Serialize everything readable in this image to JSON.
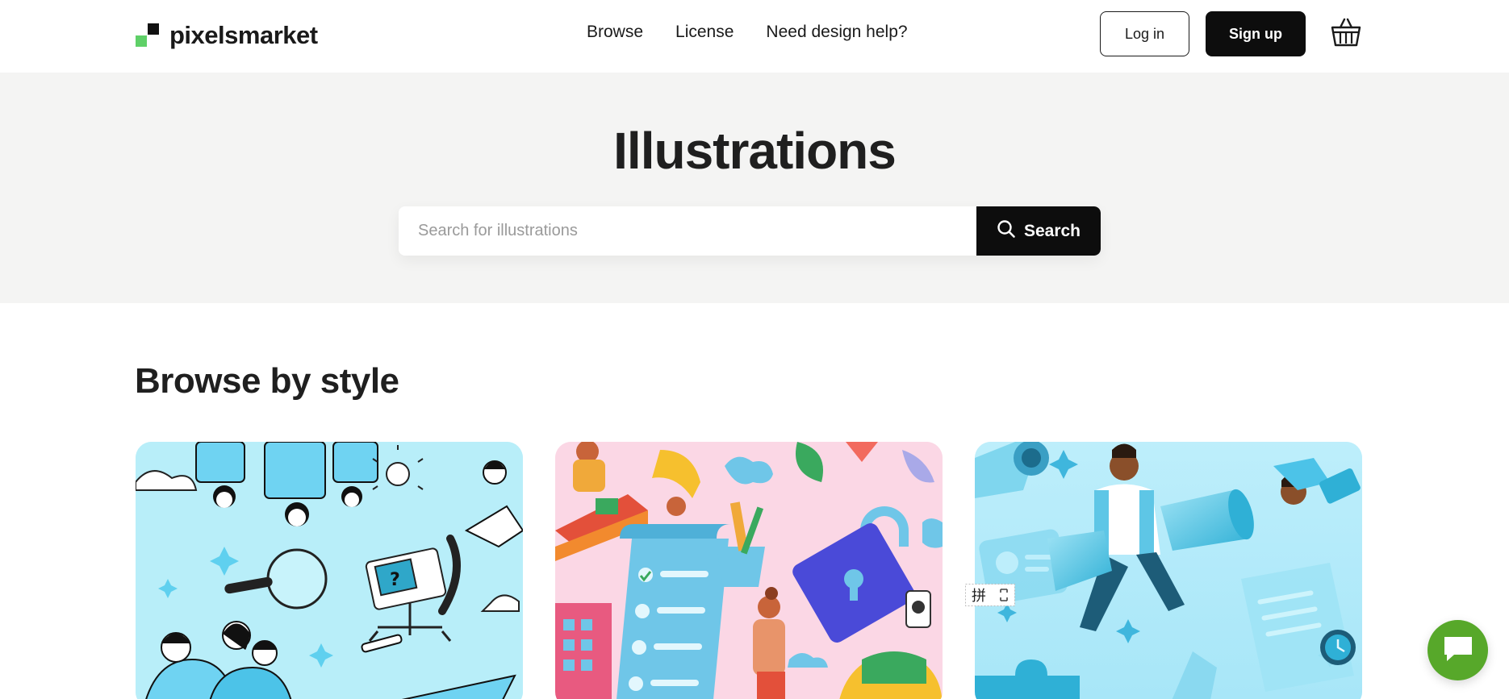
{
  "header": {
    "brand": "pixelsmarket",
    "nav": [
      {
        "label": "Browse"
      },
      {
        "label": "License"
      },
      {
        "label": "Need design help?"
      }
    ],
    "login_label": "Log in",
    "signup_label": "Sign up",
    "cart_icon": "basket-icon"
  },
  "hero": {
    "title": "Illustrations",
    "search": {
      "placeholder": "Search for illustrations",
      "value": "",
      "button_label": "Search"
    }
  },
  "section": {
    "title": "Browse by style",
    "cards": [
      {
        "image": "line-art-illustration",
        "bg_color": "#b8eef9"
      },
      {
        "image": "flat-color-illustration",
        "bg_color": "#fbd7e5"
      },
      {
        "image": "3d-gradient-illustration",
        "bg_color": "#bdeefb"
      }
    ]
  },
  "ime_widget": {
    "glyph": "拼"
  },
  "chat": {
    "icon": "chat-bubble-icon",
    "color": "#57a82a"
  },
  "colors": {
    "accent_green": "#5fd068",
    "dark": "#0d0d0d",
    "hero_bg": "#f4f4f3"
  }
}
